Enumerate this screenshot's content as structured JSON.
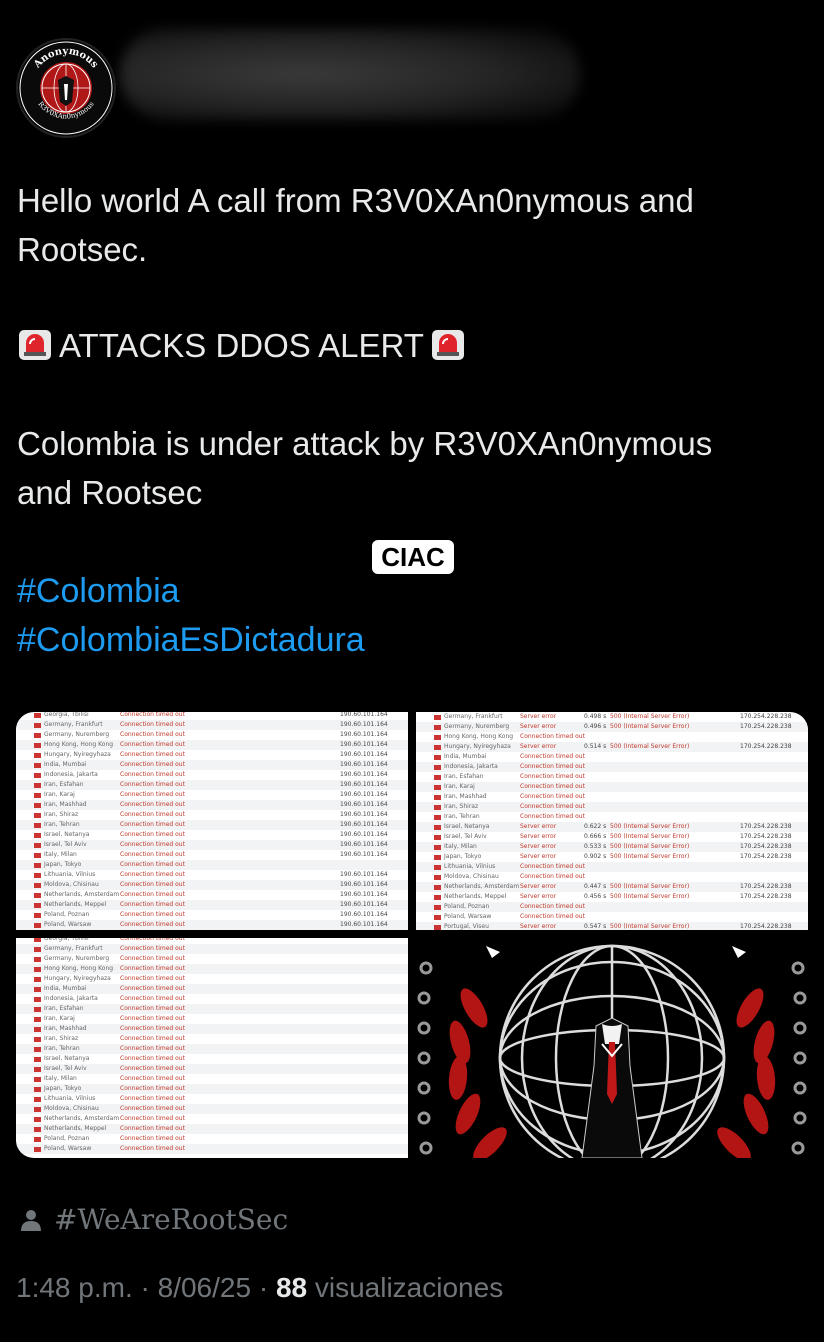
{
  "post": {
    "avatar_text_top": "Anonymous",
    "avatar_text_bottom": "R3V0XAn0nymous",
    "line1": "Hello world A call from R3V0XAn0nymous and",
    "line2": "Rootsec.",
    "alert": "ATTACKS DDOS  ALERT",
    "body1": "Colombia is under attack by R3V0XAn0nymous",
    "body2": "and Rootsec",
    "hashtag1": "#Colombia",
    "hashtag2": "#ColombiaEsDictadura",
    "badge": "CIAC"
  },
  "images": {
    "table1": [
      {
        "loc": "Georgia, Tbilisi",
        "status": "Connection timed out",
        "ip": "190.60.101.164"
      },
      {
        "loc": "Germany, Frankfurt",
        "status": "Connection timed out",
        "ip": "190.60.101.164"
      },
      {
        "loc": "Germany, Nuremberg",
        "status": "Connection timed out",
        "ip": "190.60.101.164"
      },
      {
        "loc": "Hong Kong, Hong Kong",
        "status": "Connection timed out",
        "ip": "190.60.101.164"
      },
      {
        "loc": "Hungary, Nyiregyhaza",
        "status": "Connection timed out",
        "ip": "190.60.101.164"
      },
      {
        "loc": "India, Mumbai",
        "status": "Connection timed out",
        "ip": "190.60.101.164"
      },
      {
        "loc": "Indonesia, Jakarta",
        "status": "Connection timed out",
        "ip": "190.60.101.164"
      },
      {
        "loc": "Iran, Esfahan",
        "status": "Connection timed out",
        "ip": "190.60.101.164"
      },
      {
        "loc": "Iran, Karaj",
        "status": "Connection timed out",
        "ip": "190.60.101.164"
      },
      {
        "loc": "Iran, Mashhad",
        "status": "Connection timed out",
        "ip": "190.60.101.164"
      },
      {
        "loc": "Iran, Shiraz",
        "status": "Connection timed out",
        "ip": "190.60.101.164"
      },
      {
        "loc": "Iran, Tehran",
        "status": "Connection timed out",
        "ip": "190.60.101.164"
      },
      {
        "loc": "Israel, Netanya",
        "status": "Connection timed out",
        "ip": "190.60.101.164"
      },
      {
        "loc": "Israel, Tel Aviv",
        "status": "Connection timed out",
        "ip": "190.60.101.164"
      },
      {
        "loc": "Italy, Milan",
        "status": "Connection timed out",
        "ip": "190.60.101.164"
      },
      {
        "loc": "Japan, Tokyo",
        "status": "Connection timed out",
        "ip": ""
      },
      {
        "loc": "Lithuania, Vilnius",
        "status": "Connection timed out",
        "ip": "190.60.101.164"
      },
      {
        "loc": "Moldova, Chisinau",
        "status": "Connection timed out",
        "ip": "190.60.101.164"
      },
      {
        "loc": "Netherlands, Amsterdam",
        "status": "Connection timed out",
        "ip": "190.60.101.164"
      },
      {
        "loc": "Netherlands, Meppel",
        "status": "Connection timed out",
        "ip": "190.60.101.164"
      },
      {
        "loc": "Poland, Poznan",
        "status": "Connection timed out",
        "ip": "190.60.101.164"
      },
      {
        "loc": "Poland, Warsaw",
        "status": "Connection timed out",
        "ip": "190.60.101.164"
      }
    ],
    "table2": [
      {
        "loc": "Germany, Frankfurt",
        "status": "Server error",
        "time": "0.498 s",
        "err": "500 (Internal Server Error)",
        "ip": "170.254.228.238"
      },
      {
        "loc": "Germany, Nuremberg",
        "status": "Server error",
        "time": "0.496 s",
        "err": "500 (Internal Server Error)",
        "ip": "170.254.228.238"
      },
      {
        "loc": "Hong Kong, Hong Kong",
        "status": "Connection timed out",
        "time": "",
        "err": "",
        "ip": ""
      },
      {
        "loc": "Hungary, Nyiregyhaza",
        "status": "Server error",
        "time": "0.514 s",
        "err": "500 (Internal Server Error)",
        "ip": "170.254.228.238"
      },
      {
        "loc": "India, Mumbai",
        "status": "Connection timed out",
        "time": "",
        "err": "",
        "ip": ""
      },
      {
        "loc": "Indonesia, Jakarta",
        "status": "Connection timed out",
        "time": "",
        "err": "",
        "ip": ""
      },
      {
        "loc": "Iran, Esfahan",
        "status": "Connection timed out",
        "time": "",
        "err": "",
        "ip": ""
      },
      {
        "loc": "Iran, Karaj",
        "status": "Connection timed out",
        "time": "",
        "err": "",
        "ip": ""
      },
      {
        "loc": "Iran, Mashhad",
        "status": "Connection timed out",
        "time": "",
        "err": "",
        "ip": ""
      },
      {
        "loc": "Iran, Shiraz",
        "status": "Connection timed out",
        "time": "",
        "err": "",
        "ip": ""
      },
      {
        "loc": "Iran, Tehran",
        "status": "Connection timed out",
        "time": "",
        "err": "",
        "ip": ""
      },
      {
        "loc": "Israel, Netanya",
        "status": "Server error",
        "time": "0.622 s",
        "err": "500 (Internal Server Error)",
        "ip": "170.254.228.238"
      },
      {
        "loc": "Israel, Tel Aviv",
        "status": "Server error",
        "time": "0.666 s",
        "err": "500 (Internal Server Error)",
        "ip": "170.254.228.238"
      },
      {
        "loc": "Italy, Milan",
        "status": "Server error",
        "time": "0.533 s",
        "err": "500 (Internal Server Error)",
        "ip": "170.254.228.238"
      },
      {
        "loc": "Japan, Tokyo",
        "status": "Server error",
        "time": "0.902 s",
        "err": "500 (Internal Server Error)",
        "ip": "170.254.228.238"
      },
      {
        "loc": "Lithuania, Vilnius",
        "status": "Connection timed out",
        "time": "",
        "err": "",
        "ip": ""
      },
      {
        "loc": "Moldova, Chisinau",
        "status": "Connection timed out",
        "time": "",
        "err": "",
        "ip": ""
      },
      {
        "loc": "Netherlands, Amsterdam",
        "status": "Server error",
        "time": "0.447 s",
        "err": "500 (Internal Server Error)",
        "ip": "170.254.228.238"
      },
      {
        "loc": "Netherlands, Meppel",
        "status": "Server error",
        "time": "0.456 s",
        "err": "500 (Internal Server Error)",
        "ip": "170.254.228.238"
      },
      {
        "loc": "Poland, Poznan",
        "status": "Connection timed out",
        "time": "",
        "err": "",
        "ip": ""
      },
      {
        "loc": "Poland, Warsaw",
        "status": "Connection timed out",
        "time": "",
        "err": "",
        "ip": ""
      },
      {
        "loc": "Portugal, Viseu",
        "status": "Server error",
        "time": "0.547 s",
        "err": "500 (Internal Server Error)",
        "ip": "170.254.228.238"
      }
    ],
    "table3": [
      {
        "loc": "Georgia, Tbilisi",
        "status": "Connection timed out"
      },
      {
        "loc": "Germany, Frankfurt",
        "status": "Connection timed out"
      },
      {
        "loc": "Germany, Nuremberg",
        "status": "Connection timed out"
      },
      {
        "loc": "Hong Kong, Hong Kong",
        "status": "Connection timed out"
      },
      {
        "loc": "Hungary, Nyiregyhaza",
        "status": "Connection timed out"
      },
      {
        "loc": "India, Mumbai",
        "status": "Connection timed out"
      },
      {
        "loc": "Indonesia, Jakarta",
        "status": "Connection timed out"
      },
      {
        "loc": "Iran, Esfahan",
        "status": "Connection timed out"
      },
      {
        "loc": "Iran, Karaj",
        "status": "Connection timed out"
      },
      {
        "loc": "Iran, Mashhad",
        "status": "Connection timed out"
      },
      {
        "loc": "Iran, Shiraz",
        "status": "Connection timed out"
      },
      {
        "loc": "Iran, Tehran",
        "status": "Connection timed out"
      },
      {
        "loc": "Israel, Netanya",
        "status": "Connection timed out"
      },
      {
        "loc": "Israel, Tel Aviv",
        "status": "Connection timed out"
      },
      {
        "loc": "Italy, Milan",
        "status": "Connection timed out"
      },
      {
        "loc": "Japan, Tokyo",
        "status": "Connection timed out"
      },
      {
        "loc": "Lithuania, Vilnius",
        "status": "Connection timed out"
      },
      {
        "loc": "Moldova, Chisinau",
        "status": "Connection timed out"
      },
      {
        "loc": "Netherlands, Amsterdam",
        "status": "Connection timed out"
      },
      {
        "loc": "Netherlands, Meppel",
        "status": "Connection timed out"
      },
      {
        "loc": "Poland, Poznan",
        "status": "Connection timed out"
      },
      {
        "loc": "Poland, Warsaw",
        "status": "Connection timed out"
      }
    ]
  },
  "footer": {
    "icon": "person-icon",
    "tag": "#WeAreRootSec",
    "time": "1:48 p.m.",
    "sep1": " · ",
    "date": "8/06/25",
    "sep2": " · ",
    "views_count": "88",
    "views_label": " visualizaciones"
  },
  "colors": {
    "link": "#1d9bf0",
    "text": "#e7e9ea",
    "muted": "#71767b",
    "error": "#c0392b"
  }
}
